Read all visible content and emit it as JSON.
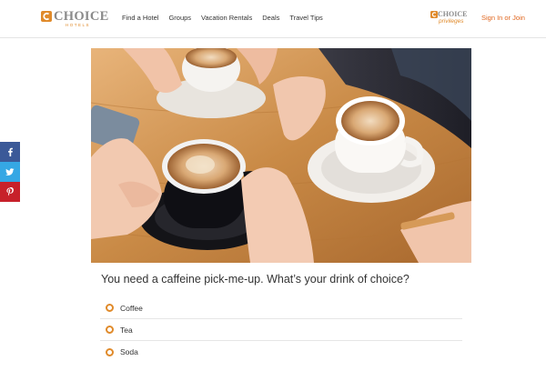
{
  "brand": {
    "logo_text": "CHOICE",
    "logo_sub": "HOTELS",
    "accent": "#e08a2a"
  },
  "nav": {
    "items": [
      "Find a Hotel",
      "Groups",
      "Vacation Rentals",
      "Deals",
      "Travel Tips"
    ]
  },
  "privileges": {
    "logo_text": "CHOICE",
    "logo_sub": "privileges"
  },
  "header": {
    "signin_label": "Sign In or Join",
    "signin_color": "#e0661e"
  },
  "social": {
    "buttons": [
      {
        "icon": "facebook-icon",
        "color": "#3b5998"
      },
      {
        "icon": "twitter-icon",
        "color": "#35a7e4"
      },
      {
        "icon": "pinterest-icon",
        "color": "#c7212a"
      }
    ]
  },
  "quiz": {
    "question": "You need a caffeine pick-me-up. What’s your drink of choice?",
    "options": [
      "Coffee",
      "Tea",
      "Soda"
    ]
  }
}
